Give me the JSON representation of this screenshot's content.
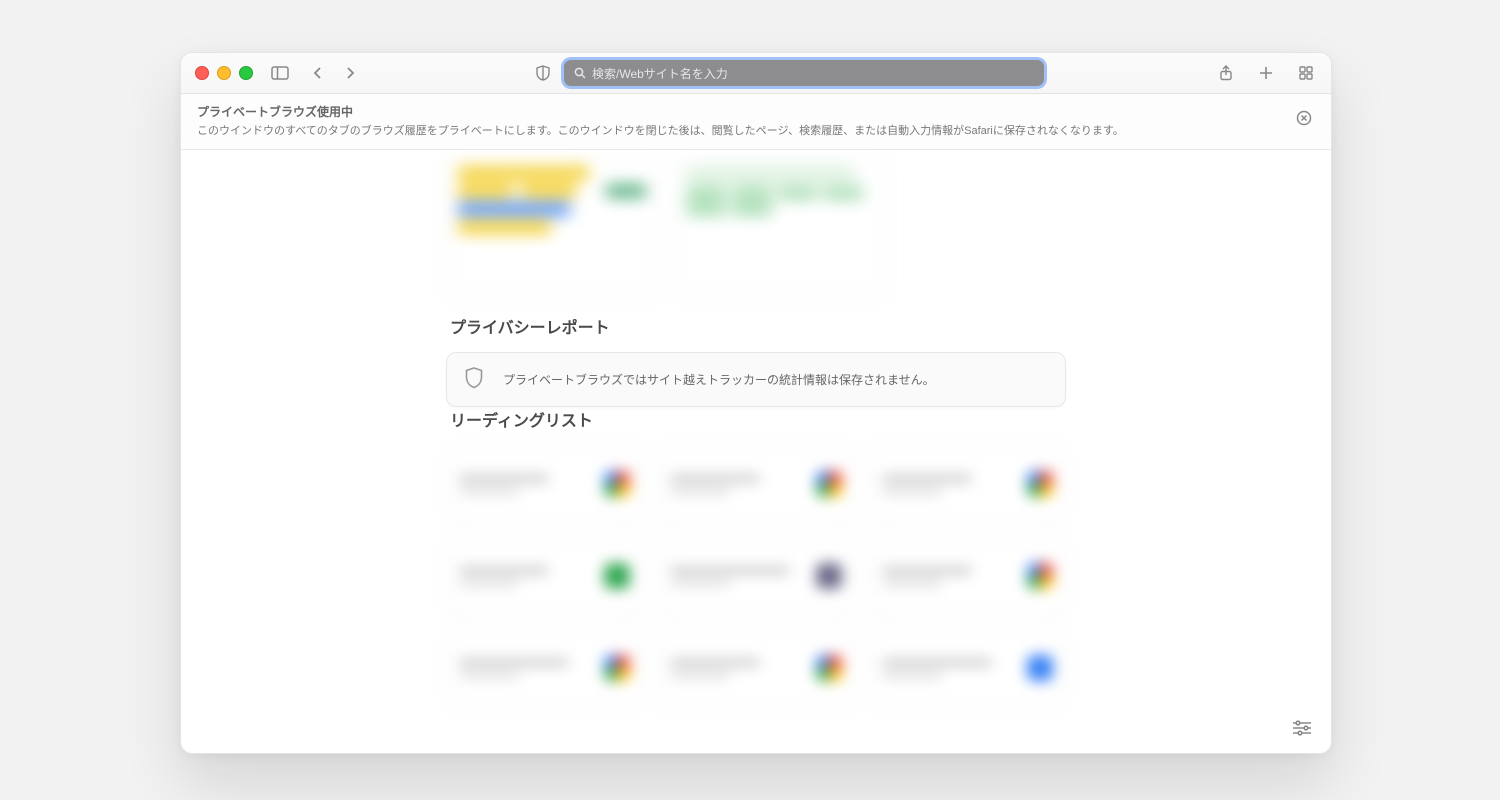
{
  "toolbar": {
    "address_placeholder": "検索/Webサイト名を入力"
  },
  "banner": {
    "title": "プライベートブラウズ使用中",
    "body": "このウインドウのすべてのタブのブラウズ履歴をプライベートにします。このウインドウを閉じた後は、閲覧したページ、検索履歴、または自動入力情報がSafariに保存されなくなります。"
  },
  "sections": {
    "privacy": {
      "title": "プライバシーレポート",
      "message": "プライベートブラウズではサイト越えトラッカーの統計情報は保存されません。"
    },
    "reading": {
      "title": "リーディングリスト"
    }
  }
}
